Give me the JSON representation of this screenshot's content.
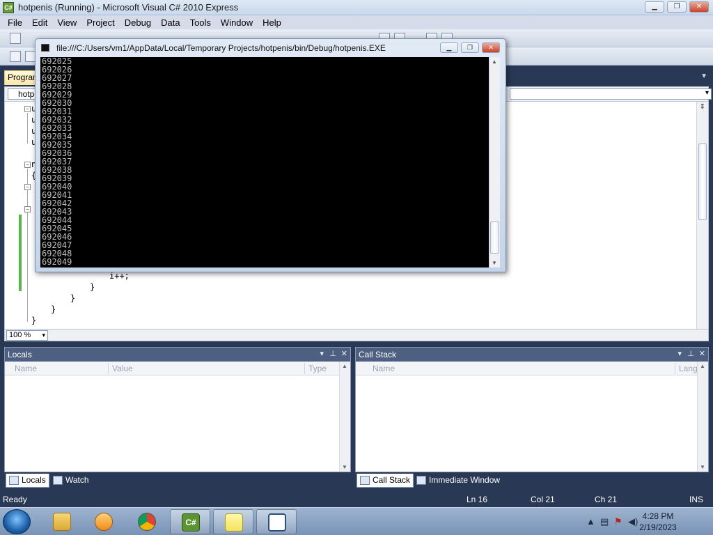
{
  "window": {
    "title": "hotpenis (Running) - Microsoft Visual C# 2010 Express",
    "app_icon_text": "C#"
  },
  "menu": [
    "File",
    "Edit",
    "View",
    "Project",
    "Debug",
    "Data",
    "Tools",
    "Window",
    "Help"
  ],
  "document_tab": {
    "label": "Program.cs"
  },
  "navbar": {
    "type_box": "hotpenis"
  },
  "editor": {
    "lines": [
      {
        "indent": 0,
        "text": "u"
      },
      {
        "indent": 0,
        "text": "u"
      },
      {
        "indent": 0,
        "text": "u"
      },
      {
        "indent": 0,
        "text": "u"
      },
      {
        "indent": 0,
        "text": "n"
      },
      {
        "indent": 0,
        "text": "{"
      },
      {
        "indent": 13,
        "text": "i++;"
      },
      {
        "indent": 10,
        "text": "}"
      },
      {
        "indent": 7,
        "text": "}"
      },
      {
        "indent": 3,
        "text": "}"
      },
      {
        "indent": 0,
        "text": "}"
      }
    ],
    "zoom": "100 %"
  },
  "console": {
    "title": "file:///C:/Users/vm1/AppData/Local/Temporary Projects/hotpenis/bin/Debug/hotpenis.EXE",
    "output": [
      "692025",
      "692026",
      "692027",
      "692028",
      "692029",
      "692030",
      "692031",
      "692032",
      "692033",
      "692034",
      "692035",
      "692036",
      "692037",
      "692038",
      "692039",
      "692040",
      "692041",
      "692042",
      "692043",
      "692044",
      "692045",
      "692046",
      "692047",
      "692048",
      "692049"
    ]
  },
  "locals_panel": {
    "title": "Locals",
    "columns": [
      "Name",
      "Value",
      "Type"
    ]
  },
  "callstack_panel": {
    "title": "Call Stack",
    "columns": [
      "Name",
      "Lang"
    ]
  },
  "bottom_tabs_left": [
    "Locals",
    "Watch"
  ],
  "bottom_tabs_right": [
    "Call Stack",
    "Immediate Window"
  ],
  "status": {
    "text": "Ready",
    "ln": "Ln 16",
    "col": "Col 21",
    "ch": "Ch 21",
    "mode": "INS"
  },
  "taskbar": {
    "apps": [
      "windows-explorer",
      "media-player",
      "google-chrome",
      "visual-csharp-express",
      "sticky-notes",
      "console-app"
    ],
    "time": "4:28 PM",
    "date": "2/19/2023"
  },
  "colors": {
    "ide_background": "#293955",
    "console_background": "#000000",
    "console_text": "#c0c0c0",
    "tab_active": "#ffe8a6"
  }
}
